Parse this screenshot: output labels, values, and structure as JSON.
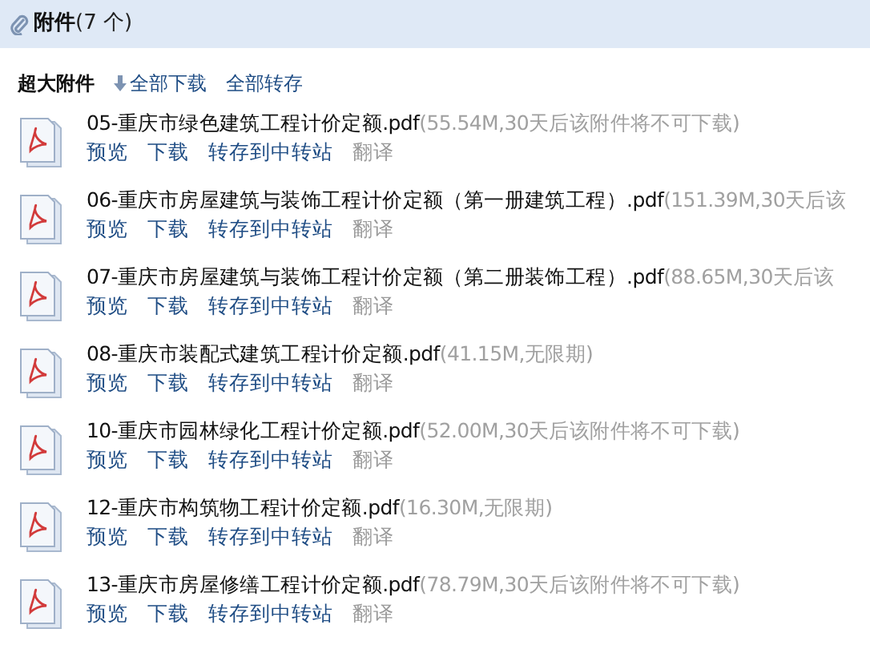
{
  "header": {
    "title": "附件",
    "count": "(7 个)"
  },
  "toolbar": {
    "label": "超大附件",
    "download_all": "全部下载",
    "save_all": "全部转存"
  },
  "files": [
    {
      "name": "05-重庆市绿色建筑工程计价定额.pdf",
      "meta": "(55.54M,30天后该附件将不可下载)",
      "actions": [
        "预览",
        "下载",
        "转存到中转站",
        "翻译"
      ]
    },
    {
      "name": "06-重庆市房屋建筑与装饰工程计价定额（第一册建筑工程）.pdf",
      "meta": "(151.39M,30天后该",
      "actions": [
        "预览",
        "下载",
        "转存到中转站",
        "翻译"
      ]
    },
    {
      "name": "07-重庆市房屋建筑与装饰工程计价定额（第二册装饰工程）.pdf",
      "meta": "(88.65M,30天后该",
      "actions": [
        "预览",
        "下载",
        "转存到中转站",
        "翻译"
      ]
    },
    {
      "name": "08-重庆市装配式建筑工程计价定额.pdf",
      "meta": "(41.15M,无限期)",
      "actions": [
        "预览",
        "下载",
        "转存到中转站",
        "翻译"
      ]
    },
    {
      "name": "10-重庆市园林绿化工程计价定额.pdf",
      "meta": "(52.00M,30天后该附件将不可下载)",
      "actions": [
        "预览",
        "下载",
        "转存到中转站",
        "翻译"
      ]
    },
    {
      "name": "12-重庆市构筑物工程计价定额.pdf",
      "meta": "(16.30M,无限期)",
      "actions": [
        "预览",
        "下载",
        "转存到中转站",
        "翻译"
      ]
    },
    {
      "name": "13-重庆市房屋修缮工程计价定额.pdf",
      "meta": "(78.79M,30天后该附件将不可下载)",
      "actions": [
        "预览",
        "下载",
        "转存到中转站",
        "翻译"
      ]
    }
  ]
}
